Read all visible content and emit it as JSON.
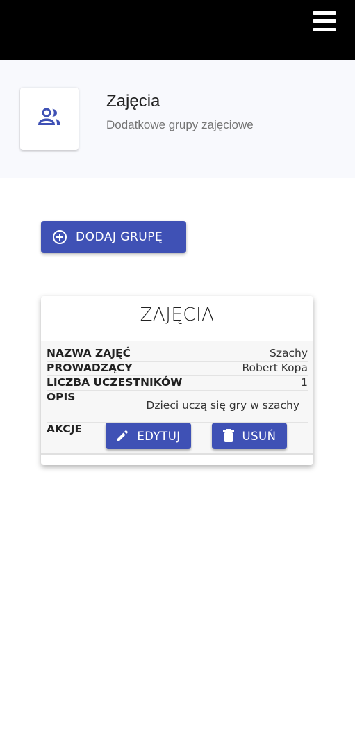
{
  "topbar": {
    "menu_icon": "hamburger-menu-icon"
  },
  "header": {
    "icon": "people-icon",
    "title": "Zajęcia",
    "subtitle": "Dodatkowe grupy zajęciowe",
    "accent_color": "#3f51b5"
  },
  "actions": {
    "add_label": "DODAJ GRUPĘ",
    "add_icon": "add-circle-icon"
  },
  "card": {
    "title": "ZAJĘCIA",
    "rows": [
      {
        "label": "NAZWA ZAJĘĆ",
        "value": "Szachy"
      },
      {
        "label": "PROWADZĄCY",
        "value": "Robert Kopa"
      },
      {
        "label": "LICZBA UCZESTNIKÓW",
        "value": "1"
      },
      {
        "label": "OPIS",
        "value": "Dzieci uczą się gry w szachy"
      },
      {
        "label": "AKCJE"
      }
    ],
    "edit_label": "EDYTUJ",
    "edit_icon": "pencil-icon",
    "delete_label": "USUŃ",
    "delete_icon": "trash-icon"
  }
}
